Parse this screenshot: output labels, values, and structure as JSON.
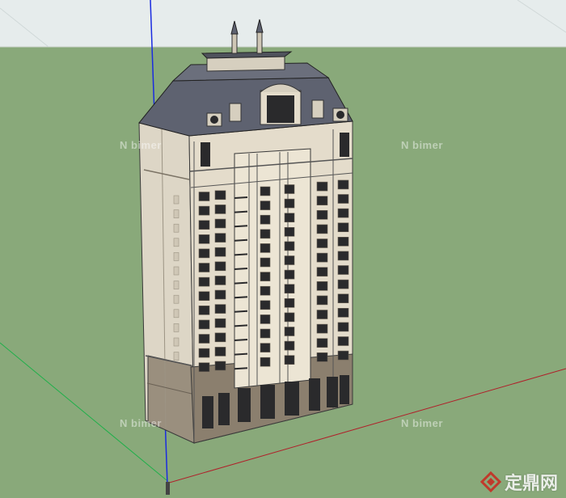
{
  "scene": {
    "subject": "SketchUp model of a high-rise residential tower",
    "colors": {
      "sky": "#e6ecec",
      "ground": "#89a97a",
      "facade": "#e4dccb",
      "facade_shadow": "#c9c0ae",
      "roof": "#5e6270",
      "window": "#2a2a2c",
      "base": "#8b7f6e",
      "axis_blue": "#1a2be0",
      "axis_red": "#b0202a",
      "axis_green": "#1fb04a"
    }
  },
  "watermarks": {
    "bimer": "bimer"
  },
  "brand": {
    "label": "定鼎网",
    "logo_icon": "diamond-logo-icon"
  }
}
